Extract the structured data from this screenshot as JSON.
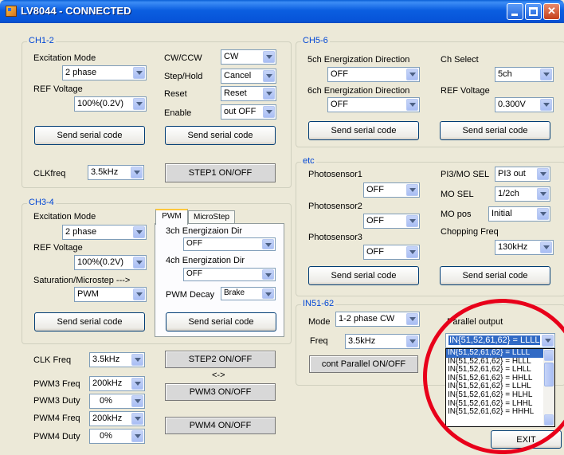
{
  "window": {
    "title": "LV8044 - CONNECTED"
  },
  "ch12": {
    "group_label": "CH1-2",
    "excitation_mode_label": "Excitation Mode",
    "excitation_mode_value": "2 phase",
    "ref_voltage_label": "REF Voltage",
    "ref_voltage_value": "100%(0.2V)",
    "cwccw_label": "CW/CCW",
    "cwccw_value": "CW",
    "step_hold_label": "Step/Hold",
    "step_hold_value": "Cancel",
    "reset_label": "Reset",
    "reset_value": "Reset",
    "enable_label": "Enable",
    "enable_value": "out OFF",
    "send_left": "Send serial code",
    "send_right": "Send serial code",
    "clkfreq_label": "CLKfreq",
    "clkfreq_value": "3.5kHz",
    "step1_button": "STEP1 ON/OFF"
  },
  "ch34": {
    "group_label": "CH3-4",
    "excitation_mode_label": "Excitation Mode",
    "excitation_mode_value": "2 phase",
    "ref_voltage_label": "REF Voltage",
    "ref_voltage_value": "100%(0.2V)",
    "saturation_label": "Saturation/Microstep --->",
    "saturation_value": "PWM",
    "send_left": "Send serial code",
    "tabs": [
      "PWM",
      "MicroStep"
    ],
    "dir3_label": "3ch Energizaion Dir",
    "dir3_value": "OFF",
    "dir4_label": "4ch Energization Dir",
    "dir4_value": "OFF",
    "pwm_decay_label": "PWM Decay",
    "pwm_decay_value": "Brake",
    "send_tab": "Send serial code",
    "clk_freq_label": "CLK Freq",
    "clk_freq_value": "3.5kHz",
    "pwm3_freq_label": "PWM3 Freq",
    "pwm3_freq_value": "200kHz",
    "pwm3_duty_label": "PWM3 Duty",
    "pwm3_duty_value": "0%",
    "pwm4_freq_label": "PWM4 Freq",
    "pwm4_freq_value": "200kHz",
    "pwm4_duty_label": "PWM4 Duty",
    "pwm4_duty_value": "0%",
    "step2_button": "STEP2 ON/OFF",
    "arrow_text": "<->",
    "pwm3_button": "PWM3 ON/OFF",
    "pwm4_button": "PWM4 ON/OFF"
  },
  "ch56": {
    "group_label": "CH5-6",
    "dir5_label": "5ch Energization Direction",
    "dir5_value": "OFF",
    "dir6_label": "6ch Energization Direction",
    "dir6_value": "OFF",
    "ch_select_label": "Ch Select",
    "ch_select_value": "5ch",
    "ref_voltage_label": "REF Voltage",
    "ref_voltage_value": "0.300V",
    "send_left": "Send serial code",
    "send_right": "Send serial code"
  },
  "etc": {
    "group_label": "etc",
    "photo1_label": "Photosensor1",
    "photo1_value": "OFF",
    "photo2_label": "Photosensor2",
    "photo2_value": "OFF",
    "photo3_label": "Photosensor3",
    "photo3_value": "OFF",
    "pi3_label": "PI3/MO SEL",
    "pi3_value": "PI3 out",
    "mo_sel_label": "MO SEL",
    "mo_sel_value": "1/2ch",
    "mo_pos_label": "MO pos",
    "mo_pos_value": "Initial",
    "chopping_label": "Chopping Freq",
    "chopping_value": "130kHz",
    "send_left": "Send serial code",
    "send_right": "Send serial code"
  },
  "in5162": {
    "group_label": "IN51-62",
    "mode_label": "Mode",
    "mode_value": "1-2 phase CW",
    "freq_label": "Freq",
    "freq_value": "3.5kHz",
    "cont_button": "cont Parallel ON/OFF",
    "parallel_label": "Parallel output",
    "parallel_value": "IN{51,52,61,62} = LLLL",
    "parallel_options": [
      "IN{51,52,61,62} = LLLL",
      "IN{51,52,61,62} = HLLL",
      "IN{51,52,61,62} = LHLL",
      "IN{51,52,61,62} = HHLL",
      "IN{51,52,61,62} = LLHL",
      "IN{51,52,61,62} = HLHL",
      "IN{51,52,61,62} = LHHL",
      "IN{51,52,61,62} = HHHL"
    ]
  },
  "exit_button": "EXIT",
  "colors": {
    "title_bar": "#0b5ee0",
    "group_label": "#0046d5",
    "highlight": "#316ac5",
    "annotation_circle": "#e8001a"
  }
}
